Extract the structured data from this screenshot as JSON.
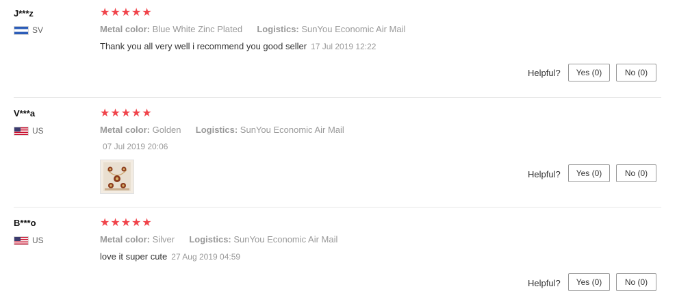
{
  "reviews": [
    {
      "user": "J***z",
      "country": "SV",
      "flag_icon": "el-salvador-flag",
      "stars": "★★★★★",
      "rating": 5,
      "attr1_label": "Metal color:",
      "attr1_value": "Blue White Zinc Plated",
      "attr2_label": "Logistics:",
      "attr2_value": "SunYou Economic Air Mail",
      "text": "Thank you all very well i recommend you good seller",
      "date": "17 Jul 2019 12:22",
      "helpful_label": "Helpful?",
      "yes_label": "Yes (0)",
      "no_label": "No (0)"
    },
    {
      "user": "V***a",
      "country": "US",
      "flag_icon": "us-flag",
      "stars": "★★★★★",
      "rating": 5,
      "attr1_label": "Metal color:",
      "attr1_value": "Golden",
      "attr2_label": "Logistics:",
      "attr2_value": "SunYou Economic Air Mail",
      "text": "",
      "date": "07 Jul 2019 20:06",
      "photo_icon": "jewelry-set-photo",
      "helpful_label": "Helpful?",
      "yes_label": "Yes (0)",
      "no_label": "No (0)"
    },
    {
      "user": "B***o",
      "country": "US",
      "flag_icon": "us-flag",
      "stars": "★★★★★",
      "rating": 5,
      "attr1_label": "Metal color:",
      "attr1_value": "Silver",
      "attr2_label": "Logistics:",
      "attr2_value": "SunYou Economic Air Mail",
      "text": "love it super cute",
      "date": "27 Aug 2019 04:59",
      "helpful_label": "Helpful?",
      "yes_label": "Yes (0)",
      "no_label": "No (0)"
    }
  ],
  "colors": {
    "star": "#f0444b",
    "muted_text": "#999999",
    "divider": "#e6e6e6"
  }
}
